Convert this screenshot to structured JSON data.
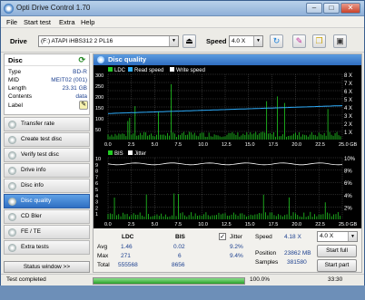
{
  "window": {
    "title": "Opti Drive Control 1.70",
    "minimize": "–",
    "maximize": "□",
    "close": "✕"
  },
  "menu": [
    "File",
    "Start test",
    "Extra",
    "Help"
  ],
  "toolbar": {
    "drive_label": "Drive",
    "drive_value": "(F:)   ATAPI iHBS312   2 PL16",
    "speed_label": "Speed",
    "speed_value": "4.0 X"
  },
  "disc": {
    "title": "Disc",
    "rows": [
      {
        "k": "Type",
        "v": "BD-R"
      },
      {
        "k": "MID",
        "v": "MEIT02 (001)"
      },
      {
        "k": "Length",
        "v": "23.31 GB"
      },
      {
        "k": "Contents",
        "v": "data"
      },
      {
        "k": "Label",
        "v": ""
      }
    ]
  },
  "nav": [
    {
      "label": "Transfer rate"
    },
    {
      "label": "Create test disc"
    },
    {
      "label": "Verify test disc"
    },
    {
      "label": "Drive info"
    },
    {
      "label": "Disc info"
    },
    {
      "label": "Disc quality",
      "active": true
    },
    {
      "label": "CD Bler"
    },
    {
      "label": "FE / TE"
    },
    {
      "label": "Extra tests"
    }
  ],
  "status_window_btn": "Status window >>",
  "main": {
    "title": "Disc quality",
    "chart1_legend": [
      "LDC",
      "Read speed",
      "Write speed"
    ],
    "chart1_y_right": [
      "8 X",
      "7 X",
      "6 X",
      "5 X",
      "4 X",
      "3 X",
      "2 X",
      "1 X"
    ],
    "chart1_y_left": [
      "300",
      "250",
      "200",
      "150",
      "100",
      "50"
    ],
    "chart2_legend": [
      "BIS",
      "Jitter"
    ],
    "chart2_y_right": [
      "10%",
      "8%",
      "6%",
      "4%",
      "2%"
    ],
    "chart2_y_left": [
      "10",
      "9",
      "8",
      "7",
      "6",
      "5",
      "4",
      "3",
      "2",
      "1"
    ],
    "x_ticks": [
      "0.0",
      "2.5",
      "5.0",
      "7.5",
      "10.0",
      "12.5",
      "15.0",
      "17.5",
      "20.0",
      "22.5",
      "25.0 GB"
    ]
  },
  "stats": {
    "col_ldc": "LDC",
    "col_bis": "BIS",
    "avg_label": "Avg",
    "avg_ldc": "1.46",
    "avg_bis": "0.02",
    "max_label": "Max",
    "max_ldc": "271",
    "max_bis": "6",
    "total_label": "Total",
    "total_ldc": "555568",
    "total_bis": "8656",
    "jitter_label": "Jitter",
    "jitter_avg": "9.2%",
    "jitter_max": "9.4%",
    "speed_label": "Speed",
    "speed_value": "4.18 X",
    "speed_select": "4.0 X",
    "position_label": "Position",
    "position_value": "23862 MB",
    "samples_label": "Samples",
    "samples_value": "381580",
    "start_full": "Start full",
    "start_part": "Start part"
  },
  "statusbar": {
    "text": "Test completed",
    "percent": "100.0%",
    "progress": 1.0,
    "time": "33:30"
  },
  "colors": {
    "ldc": "#22cc22",
    "read": "#2fb0ff",
    "bis": "#22cc22",
    "jitter": "#ffffff",
    "accent": "#2e6cbf"
  }
}
